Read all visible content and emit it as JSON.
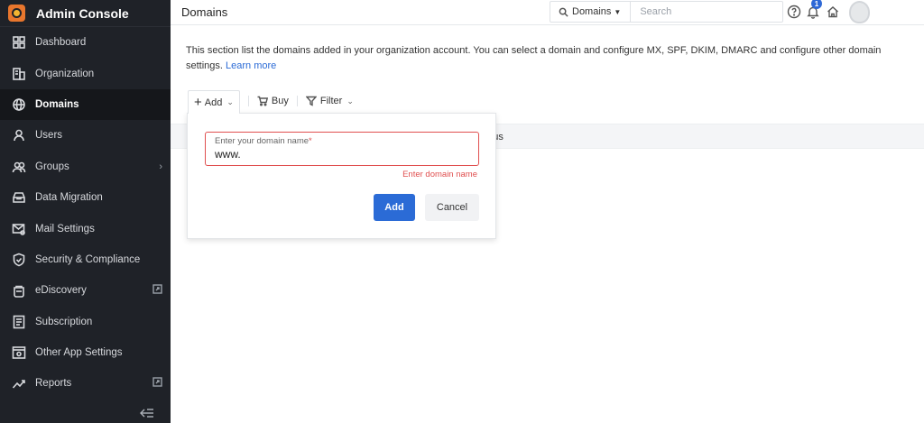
{
  "app": {
    "title": "Admin Console"
  },
  "sidebar": {
    "items": [
      {
        "label": "Dashboard",
        "icon": "dashboard-icon"
      },
      {
        "label": "Organization",
        "icon": "organization-icon"
      },
      {
        "label": "Domains",
        "icon": "globe-icon",
        "active": true
      },
      {
        "label": "Users",
        "icon": "user-icon"
      },
      {
        "label": "Groups",
        "icon": "groups-icon",
        "trailing": "chevron-right-icon"
      },
      {
        "label": "Data Migration",
        "icon": "migration-icon"
      },
      {
        "label": "Mail Settings",
        "icon": "mail-settings-icon"
      },
      {
        "label": "Security & Compliance",
        "icon": "shield-icon"
      },
      {
        "label": "eDiscovery",
        "icon": "ediscovery-icon",
        "trailing": "external-link-icon"
      },
      {
        "label": "Subscription",
        "icon": "subscription-icon"
      },
      {
        "label": "Other App Settings",
        "icon": "app-settings-icon"
      },
      {
        "label": "Reports",
        "icon": "reports-icon",
        "trailing": "external-link-icon"
      }
    ],
    "collapse_icon": "collapse-sidebar-icon"
  },
  "header": {
    "title": "Domains",
    "search": {
      "scope": "Domains",
      "placeholder": "Search"
    },
    "notification_count": "1"
  },
  "main": {
    "description": "This section list the domains added in your organization account. You can select a domain and configure MX, SPF, DKIM, DMARC and configure other domain settings.",
    "learn_more": "Learn more",
    "toolbar": {
      "add": "Add",
      "buy": "Buy",
      "filter": "Filter"
    },
    "table": {
      "status_header": "tatus"
    }
  },
  "popup": {
    "field_label": "Enter your domain name",
    "required_mark": "*",
    "field_value": "www.",
    "error": "Enter domain name",
    "add_button": "Add",
    "cancel_button": "Cancel"
  },
  "colors": {
    "sidebar_bg": "#1f2228",
    "accent": "#2b6bd6",
    "error": "#e04f4f"
  }
}
